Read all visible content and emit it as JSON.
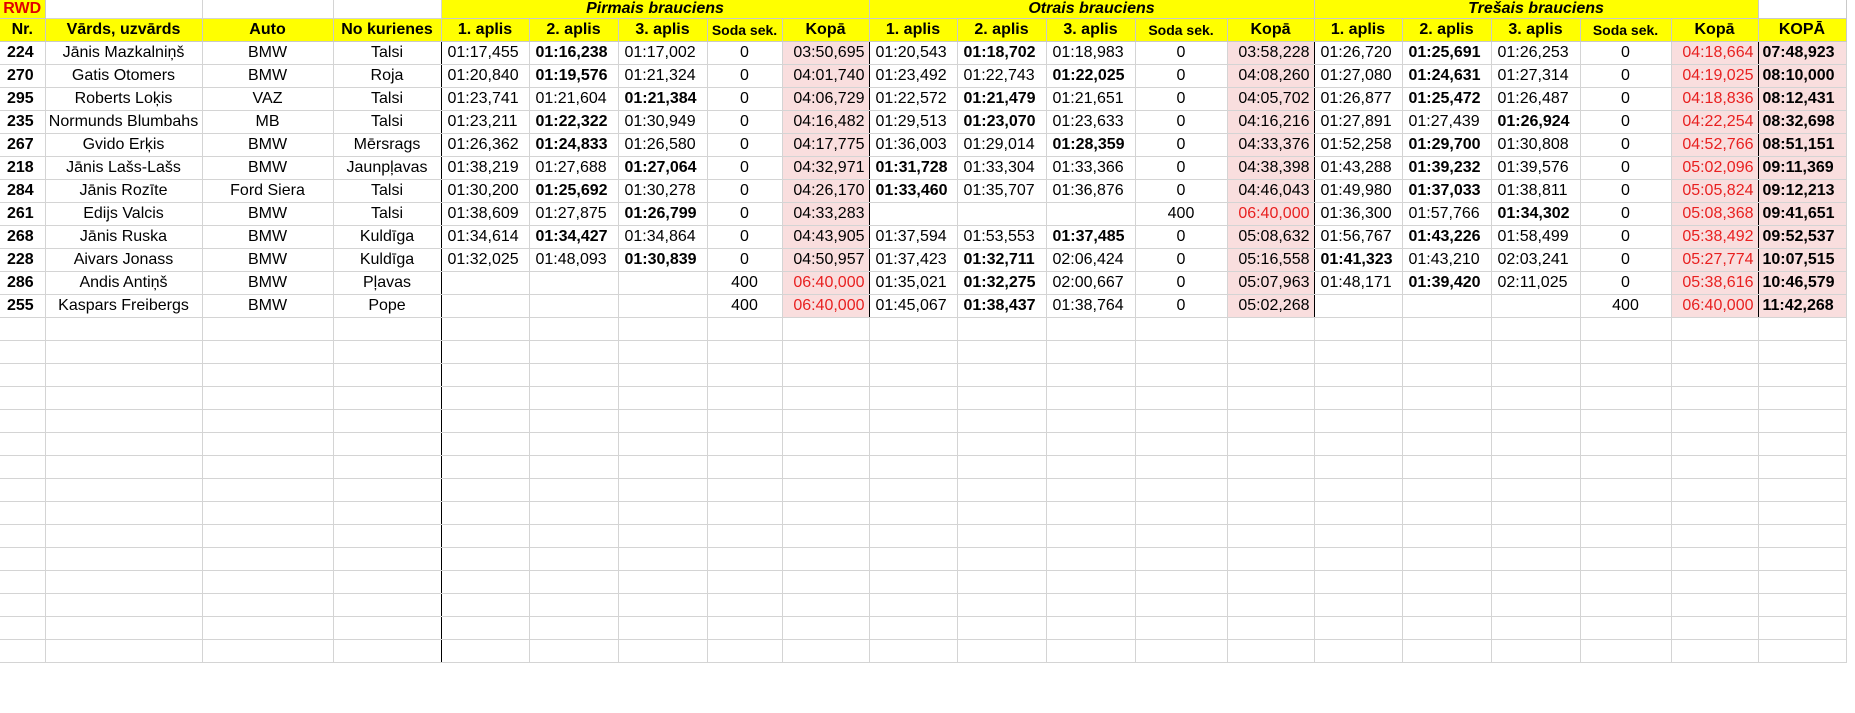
{
  "sheet_title": "RWD",
  "groups": [
    "Pirmais brauciens",
    "Otrais brauciens",
    "Trešais brauciens"
  ],
  "headers": {
    "nr": "Nr.",
    "name": "Vārds, uzvārds",
    "auto": "Auto",
    "from": "No kurienes",
    "lap1": "1. aplis",
    "lap2": "2. aplis",
    "lap3": "3. aplis",
    "penalty": "Soda sek.",
    "sum": "Kopā",
    "total": "KOPĀ"
  },
  "rows": [
    {
      "nr": "224",
      "name": "Jānis Mazkalniņš",
      "auto": "BMW",
      "from": "Talsi",
      "r": [
        [
          "01:17,455",
          "01:16,238",
          "01:17,002",
          "0",
          "03:50,695"
        ],
        [
          "01:20,543",
          "01:18,702",
          "01:18,983",
          "0",
          "03:58,228"
        ],
        [
          "01:26,720",
          "01:25,691",
          "01:26,253",
          "0",
          "04:18,664"
        ]
      ],
      "total": "07:48,923"
    },
    {
      "nr": "270",
      "name": "Gatis Otomers",
      "auto": "BMW",
      "from": "Roja",
      "r": [
        [
          "01:20,840",
          "01:19,576",
          "01:21,324",
          "0",
          "04:01,740"
        ],
        [
          "01:23,492",
          "01:22,743",
          "01:22,025",
          "0",
          "04:08,260"
        ],
        [
          "01:27,080",
          "01:24,631",
          "01:27,314",
          "0",
          "04:19,025"
        ]
      ],
      "total": "08:10,000"
    },
    {
      "nr": "295",
      "name": "Roberts Loķis",
      "auto": "VAZ",
      "from": "Talsi",
      "r": [
        [
          "01:23,741",
          "01:21,604",
          "01:21,384",
          "0",
          "04:06,729"
        ],
        [
          "01:22,572",
          "01:21,479",
          "01:21,651",
          "0",
          "04:05,702"
        ],
        [
          "01:26,877",
          "01:25,472",
          "01:26,487",
          "0",
          "04:18,836"
        ]
      ],
      "total": "08:12,431"
    },
    {
      "nr": "235",
      "name": "Normunds Blumbahs",
      "auto": "MB",
      "from": "Talsi",
      "r": [
        [
          "01:23,211",
          "01:22,322",
          "01:30,949",
          "0",
          "04:16,482"
        ],
        [
          "01:29,513",
          "01:23,070",
          "01:23,633",
          "0",
          "04:16,216"
        ],
        [
          "01:27,891",
          "01:27,439",
          "01:26,924",
          "0",
          "04:22,254"
        ]
      ],
      "total": "08:32,698"
    },
    {
      "nr": "267",
      "name": "Gvido Erķis",
      "auto": "BMW",
      "from": "Mērsrags",
      "r": [
        [
          "01:26,362",
          "01:24,833",
          "01:26,580",
          "0",
          "04:17,775"
        ],
        [
          "01:36,003",
          "01:29,014",
          "01:28,359",
          "0",
          "04:33,376"
        ],
        [
          "01:52,258",
          "01:29,700",
          "01:30,808",
          "0",
          "04:52,766"
        ]
      ],
      "total": "08:51,151"
    },
    {
      "nr": "218",
      "name": "Jānis Lašs-Lašs",
      "auto": "BMW",
      "from": "Jaunpļavas",
      "r": [
        [
          "01:38,219",
          "01:27,688",
          "01:27,064",
          "0",
          "04:32,971"
        ],
        [
          "01:31,728",
          "01:33,304",
          "01:33,366",
          "0",
          "04:38,398"
        ],
        [
          "01:43,288",
          "01:39,232",
          "01:39,576",
          "0",
          "05:02,096"
        ]
      ],
      "total": "09:11,369"
    },
    {
      "nr": "284",
      "name": "Jānis Rozīte",
      "auto": "Ford Siera",
      "from": "Talsi",
      "r": [
        [
          "01:30,200",
          "01:25,692",
          "01:30,278",
          "0",
          "04:26,170"
        ],
        [
          "01:33,460",
          "01:35,707",
          "01:36,876",
          "0",
          "04:46,043"
        ],
        [
          "01:49,980",
          "01:37,033",
          "01:38,811",
          "0",
          "05:05,824"
        ]
      ],
      "total": "09:12,213"
    },
    {
      "nr": "261",
      "name": "Edijs Valcis",
      "auto": "BMW",
      "from": "Talsi",
      "r": [
        [
          "01:38,609",
          "01:27,875",
          "01:26,799",
          "0",
          "04:33,283"
        ],
        [
          "",
          "",
          "",
          "400",
          "06:40,000"
        ],
        [
          "01:36,300",
          "01:57,766",
          "01:34,302",
          "0",
          "05:08,368"
        ]
      ],
      "total": "09:41,651"
    },
    {
      "nr": "268",
      "name": "Jānis Ruska",
      "auto": "BMW",
      "from": "Kuldīga",
      "r": [
        [
          "01:34,614",
          "01:34,427",
          "01:34,864",
          "0",
          "04:43,905"
        ],
        [
          "01:37,594",
          "01:53,553",
          "01:37,485",
          "0",
          "05:08,632"
        ],
        [
          "01:56,767",
          "01:43,226",
          "01:58,499",
          "0",
          "05:38,492"
        ]
      ],
      "total": "09:52,537"
    },
    {
      "nr": "228",
      "name": "Aivars Jonass",
      "auto": "BMW",
      "from": "Kuldīga",
      "r": [
        [
          "01:32,025",
          "01:48,093",
          "01:30,839",
          "0",
          "04:50,957"
        ],
        [
          "01:37,423",
          "01:32,711",
          "02:06,424",
          "0",
          "05:16,558"
        ],
        [
          "01:41,323",
          "01:43,210",
          "02:03,241",
          "0",
          "05:27,774"
        ]
      ],
      "total": "10:07,515"
    },
    {
      "nr": "286",
      "name": "Andis Antiņš",
      "auto": "BMW",
      "from": "Pļavas",
      "r": [
        [
          "",
          "",
          "",
          "400",
          "06:40,000"
        ],
        [
          "01:35,021",
          "01:32,275",
          "02:00,667",
          "0",
          "05:07,963"
        ],
        [
          "01:48,171",
          "01:39,420",
          "02:11,025",
          "0",
          "05:38,616"
        ]
      ],
      "total": "10:46,579"
    },
    {
      "nr": "255",
      "name": "Kaspars Freibergs",
      "auto": "BMW",
      "from": "Pope",
      "r": [
        [
          "",
          "",
          "",
          "400",
          "06:40,000"
        ],
        [
          "01:45,067",
          "01:38,437",
          "01:38,764",
          "0",
          "05:02,268"
        ],
        [
          "",
          "",
          "",
          "400",
          "06:40,000"
        ]
      ],
      "total": "11:42,268"
    }
  ]
}
